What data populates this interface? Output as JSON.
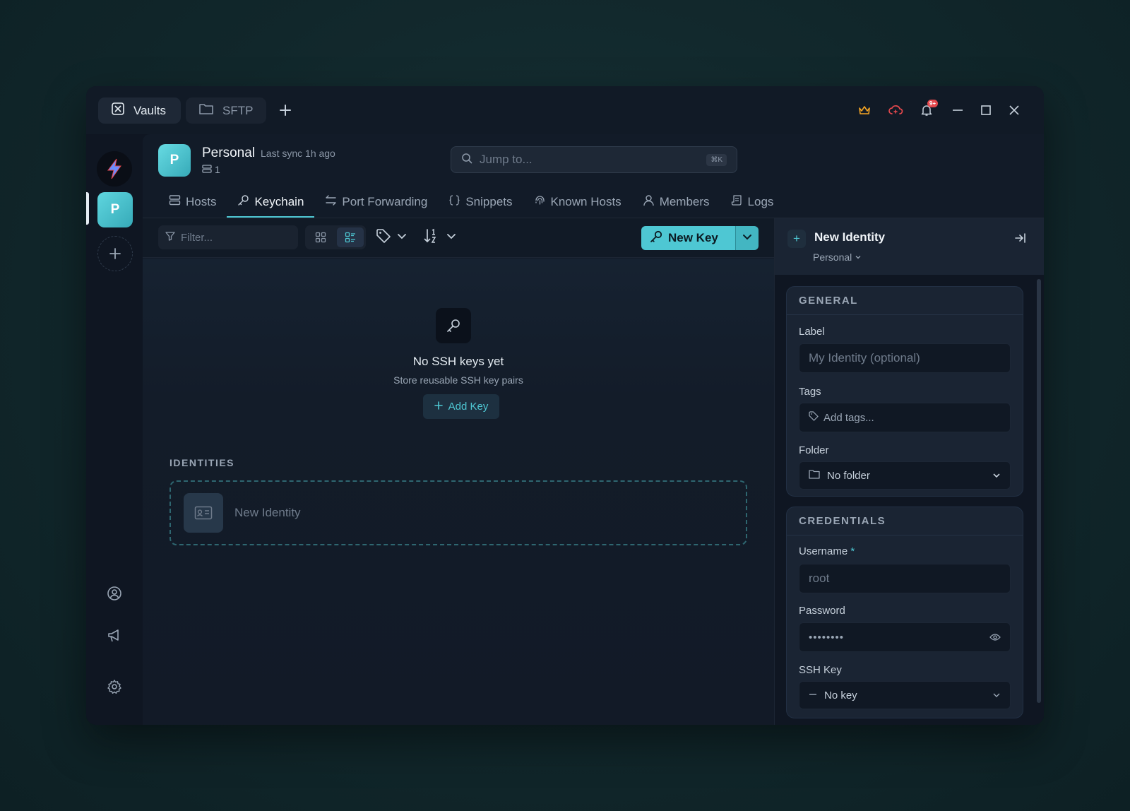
{
  "titlebar": {
    "tabs": [
      {
        "label": "Vaults",
        "icon": "vault-icon"
      },
      {
        "label": "SFTP",
        "icon": "folder-icon"
      }
    ],
    "notification_badge": "9+"
  },
  "vault": {
    "avatar_letter": "P",
    "name": "Personal",
    "sync_status": "Last sync 1h ago",
    "host_count": "1"
  },
  "search": {
    "placeholder": "Jump to...",
    "shortcut": "⌘K"
  },
  "nav": {
    "tabs": [
      "Hosts",
      "Keychain",
      "Port Forwarding",
      "Snippets",
      "Known Hosts",
      "Members",
      "Logs"
    ],
    "active": "Keychain"
  },
  "toolbar": {
    "filter_placeholder": "Filter...",
    "new_key_label": "New Key"
  },
  "empty_state": {
    "title": "No SSH keys yet",
    "subtitle": "Store reusable SSH key pairs",
    "add_button": "Add Key"
  },
  "identities": {
    "section_title": "IDENTITIES",
    "new_identity_label": "New Identity"
  },
  "panel": {
    "title": "New Identity",
    "vault_selector": "Personal",
    "general": {
      "title": "GENERAL",
      "label_label": "Label",
      "label_placeholder": "My Identity (optional)",
      "tags_label": "Tags",
      "tags_placeholder": "Add tags...",
      "folder_label": "Folder",
      "folder_value": "No folder"
    },
    "credentials": {
      "title": "CREDENTIALS",
      "username_label": "Username",
      "username_required": "*",
      "username_placeholder": "root",
      "password_label": "Password",
      "password_value": "••••••••",
      "ssh_key_label": "SSH Key",
      "ssh_key_value": "No key"
    }
  },
  "colors": {
    "accent": "#4ec7d3",
    "background": "#0f1622",
    "danger": "#e5484d",
    "premium": "#f5a524"
  }
}
